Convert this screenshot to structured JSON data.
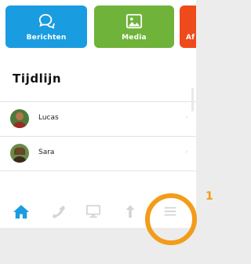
{
  "tiles": {
    "berichten": {
      "label": "Berichten",
      "color": "#1a9ce0",
      "icon": "chat-icon"
    },
    "media": {
      "label": "Media",
      "color": "#6fb33a",
      "icon": "media-icon"
    },
    "third": {
      "label": "Af",
      "color": "#ef4a1b"
    }
  },
  "section": {
    "title": "Tijdlijn"
  },
  "items": [
    {
      "name": "Lucas",
      "avatar_color": "#7a3b2a"
    },
    {
      "name": "Sara",
      "avatar_color": "#7c5a2e"
    }
  ],
  "tabbar": {
    "tabs": [
      {
        "icon": "home-icon",
        "active": true,
        "color": "#1a9ce0"
      },
      {
        "icon": "phone-icon",
        "active": false
      },
      {
        "icon": "monitor-icon",
        "active": false
      },
      {
        "icon": "upload-icon",
        "active": false
      },
      {
        "icon": "menu-icon",
        "active": false
      }
    ],
    "inactive_color": "#d5d5d5"
  },
  "annotation": {
    "number": "1",
    "color": "#f39c1a"
  }
}
